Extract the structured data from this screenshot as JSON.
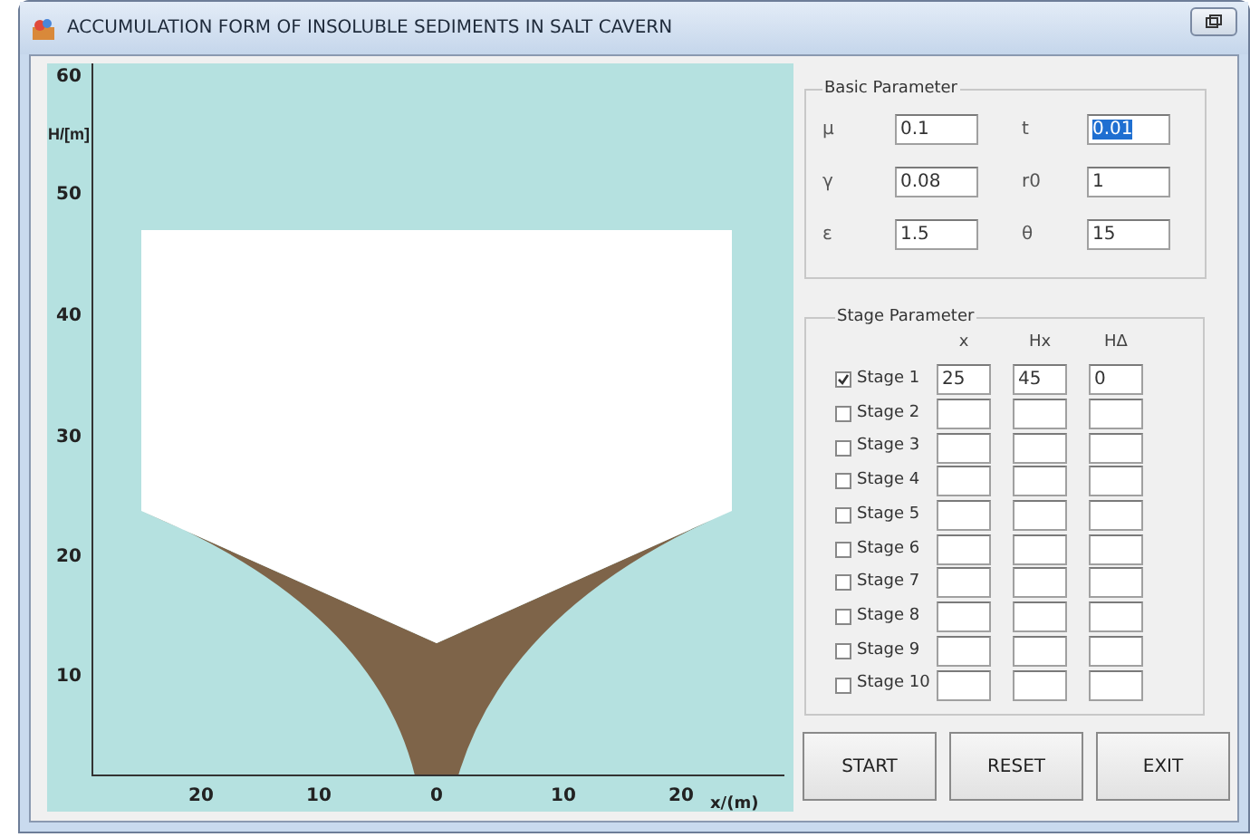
{
  "window": {
    "title": "ACCUMULATION FORM OF INSOLUBLE SEDIMENTS IN SALT CAVERN"
  },
  "plot": {
    "y_label": "H/[m]",
    "x_label": "x/(m)",
    "y_ticks": [
      "60",
      "50",
      "40",
      "30",
      "20",
      "10"
    ],
    "x_ticks": [
      "20",
      "10",
      "0",
      "10",
      "20"
    ]
  },
  "basic_parameter": {
    "title": "Basic Parameter",
    "fields": [
      {
        "label": "μ",
        "value": "0.1",
        "selected": false
      },
      {
        "label": "t",
        "value": "0.01",
        "selected": true
      },
      {
        "label": "γ",
        "value": "0.08",
        "selected": false
      },
      {
        "label": "r0",
        "value": "1",
        "selected": false
      },
      {
        "label": "ε",
        "value": "1.5",
        "selected": false
      },
      {
        "label": "θ",
        "value": "15",
        "selected": false
      }
    ]
  },
  "stage_parameter": {
    "title": "Stage Parameter",
    "columns": [
      "x",
      "Hx",
      "HΔ"
    ],
    "rows": [
      {
        "label": "Stage 1",
        "checked": true,
        "values": [
          "25",
          "45",
          "0"
        ]
      },
      {
        "label": "Stage 2",
        "checked": false
      },
      {
        "label": "Stage 3",
        "checked": false
      },
      {
        "label": "Stage 4",
        "checked": false
      },
      {
        "label": "Stage 5",
        "checked": false
      },
      {
        "label": "Stage 6",
        "checked": false
      },
      {
        "label": "Stage 7",
        "checked": false
      },
      {
        "label": "Stage 8",
        "checked": false
      },
      {
        "label": "Stage 9",
        "checked": false
      },
      {
        "label": "Stage 10",
        "checked": false
      }
    ]
  },
  "buttons": [
    "START",
    "RESET",
    "EXIT"
  ]
}
